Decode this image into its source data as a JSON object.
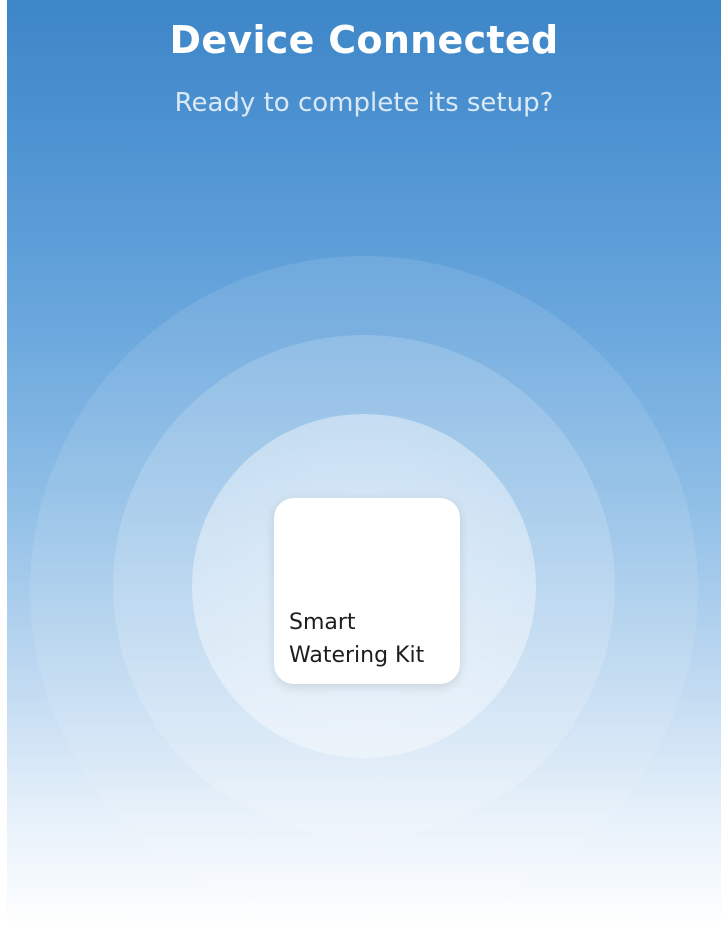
{
  "header": {
    "title": "Device Connected",
    "subtitle": "Ready to complete its setup?"
  },
  "device": {
    "name": "Smart\nWatering Kit"
  }
}
